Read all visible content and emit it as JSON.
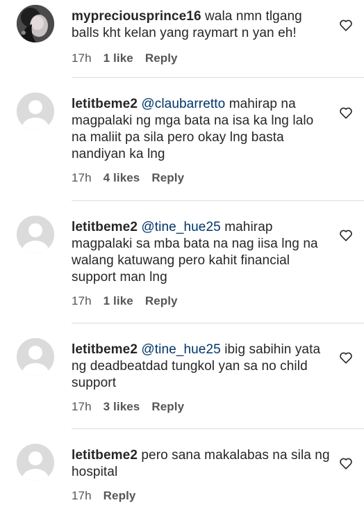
{
  "comments": [
    {
      "username": "mypreciousprince16",
      "text_parts": [
        " wala nmn tlgang balls kht kelan yang raymart n yan eh!"
      ],
      "time": "17h",
      "likes": "1 like",
      "reply": "Reply",
      "avatar": "photo"
    },
    {
      "username": "letitbeme2",
      "mention": "@claubarretto",
      "text": " mahirap na magpalaki ng  mga bata na isa ka lng lalo na maliit pa sila  pero okay lng basta nandiyan ka lng",
      "time": "17h",
      "likes": "4 likes",
      "reply": "Reply",
      "avatar": "default"
    },
    {
      "username": "letitbeme2",
      "mention": "@tine_hue25",
      "text": " mahirap magpalaki sa mba bata na nag iisa  lng na walang katuwang pero kahit financial support man lng",
      "time": "17h",
      "likes": "1 like",
      "reply": "Reply",
      "avatar": "default"
    },
    {
      "username": "letitbeme2",
      "mention": "@tine_hue25",
      "text": " ibig sabihin yata ng deadbeatdad tungkol yan sa no child support",
      "time": "17h",
      "likes": "3 likes",
      "reply": "Reply",
      "avatar": "default"
    },
    {
      "username": "letitbeme2",
      "text": " pero sana makalabas na sila ng hospital",
      "time": "17h",
      "reply": "Reply",
      "avatar": "default"
    }
  ],
  "colors": {
    "mention": "#003569",
    "meta": "#8e8e8e",
    "divider": "#dbdbdb",
    "avatar_bg": "#dbdbdb"
  },
  "icons": {
    "like": "heart-outline-icon",
    "avatar_placeholder": "user-silhouette-icon"
  }
}
